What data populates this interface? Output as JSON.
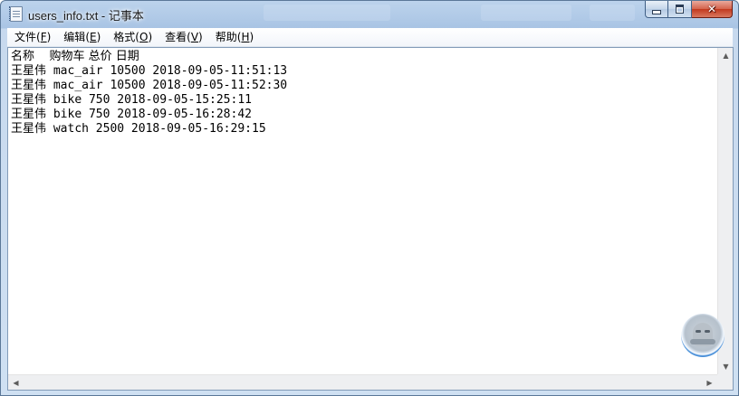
{
  "window": {
    "title": "users_info.txt - 记事本",
    "close_glyph": "✕"
  },
  "menu": [
    {
      "label": "文件",
      "accel": "F"
    },
    {
      "label": "编辑",
      "accel": "E"
    },
    {
      "label": "格式",
      "accel": "O"
    },
    {
      "label": "查看",
      "accel": "V"
    },
    {
      "label": "帮助",
      "accel": "H"
    }
  ],
  "document": {
    "lines": [
      {
        "name": "名称",
        "rest": "    购物车 总价 日期"
      },
      {
        "name": "王星伟",
        "rest": " mac_air 10500 2018-09-05-11:51:13"
      },
      {
        "name": "王星伟",
        "rest": " mac_air 10500 2018-09-05-11:52:30"
      },
      {
        "name": "王星伟",
        "rest": " bike 750 2018-09-05-15:25:11"
      },
      {
        "name": "王星伟",
        "rest": " bike 750 2018-09-05-16:28:42"
      },
      {
        "name": "王星伟",
        "rest": " watch 2500 2018-09-05-16:29:15"
      }
    ]
  },
  "scrollbar": {
    "up_glyph": "▲",
    "down_glyph": "▼",
    "left_glyph": "◀",
    "right_glyph": "▶"
  },
  "icons": {
    "app": "notepad-icon",
    "assistant": "floating-assistant-icon"
  }
}
